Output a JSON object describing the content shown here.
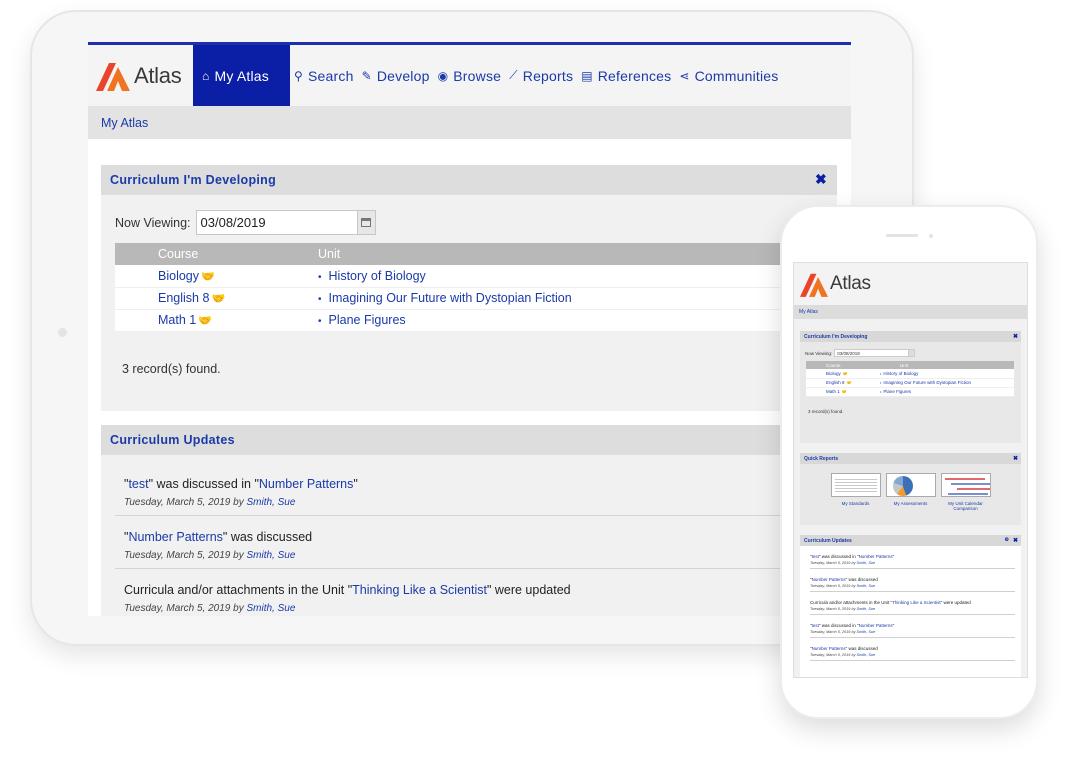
{
  "brand": "Atlas",
  "colors": {
    "primary": "#0a1fa6",
    "link": "#1a3aa8",
    "logo_orange": "#f07322",
    "logo_red": "#e8452c"
  },
  "nav": [
    {
      "icon": "home-icon",
      "glyph": "⌂",
      "label": "My Atlas",
      "active": true
    },
    {
      "icon": "search-icon",
      "glyph": "⚲",
      "label": "Search"
    },
    {
      "icon": "edit-icon",
      "glyph": "✎",
      "label": "Develop"
    },
    {
      "icon": "globe-icon",
      "glyph": "◉",
      "label": "Browse"
    },
    {
      "icon": "chart-icon",
      "glyph": "⟋",
      "label": "Reports"
    },
    {
      "icon": "book-icon",
      "glyph": "▤",
      "label": "References"
    },
    {
      "icon": "share-icon",
      "glyph": "⋖",
      "label": "Communities"
    }
  ],
  "breadcrumb": "My Atlas",
  "developing": {
    "title": "Curriculum I'm Developing",
    "close": "✖",
    "viewing_label": "Now Viewing:",
    "date": "03/08/2019",
    "columns": [
      "Course",
      "Unit"
    ],
    "rows": [
      {
        "course": "Biology",
        "unit": "History of Biology"
      },
      {
        "course": "English 8",
        "unit": "Imagining Our Future with Dystopian Fiction"
      },
      {
        "course": "Math 1",
        "unit": "Plane Figures"
      }
    ],
    "records": "3 record(s) found."
  },
  "updates": {
    "title": "Curriculum Updates",
    "items": [
      {
        "pre": "\"",
        "link": "test",
        "mid": "\" was discussed in \"",
        "link2": "Number Patterns",
        "post": "\"",
        "date": "Tuesday, March 5, 2019",
        "by": "by",
        "author": "Smith, Sue"
      },
      {
        "pre": "\"",
        "link": "Number Patterns",
        "mid": "\" was discussed",
        "link2": "",
        "post": "",
        "date": "Tuesday, March 5, 2019",
        "by": "by",
        "author": "Smith, Sue"
      },
      {
        "pre": "Curricula and/or attachments in the Unit \"",
        "link": "Thinking Like a Scientist",
        "mid": "\" were updated",
        "link2": "",
        "post": "",
        "date": "Tuesday, March 5, 2019",
        "by": "by",
        "author": "Smith, Sue"
      }
    ]
  },
  "phone": {
    "quick_reports_title": "Quick Reports",
    "quick_reports": [
      "My Standards",
      "My Assessments",
      "My Unit Calendar Comparison"
    ],
    "extra_updates": [
      {
        "pre": "\"",
        "link": "test",
        "mid": "\" was discussed in \"",
        "link2": "Number Patterns",
        "post": "\"",
        "date": "Tuesday, March 5, 2019",
        "by": "by",
        "author": "Smith, Sue"
      },
      {
        "pre": "\"",
        "link": "Number Patterns",
        "mid": "\" was discussed",
        "link2": "",
        "post": "",
        "date": "Tuesday, March 5, 2019",
        "by": "by",
        "author": "Smith, Sue"
      }
    ]
  }
}
